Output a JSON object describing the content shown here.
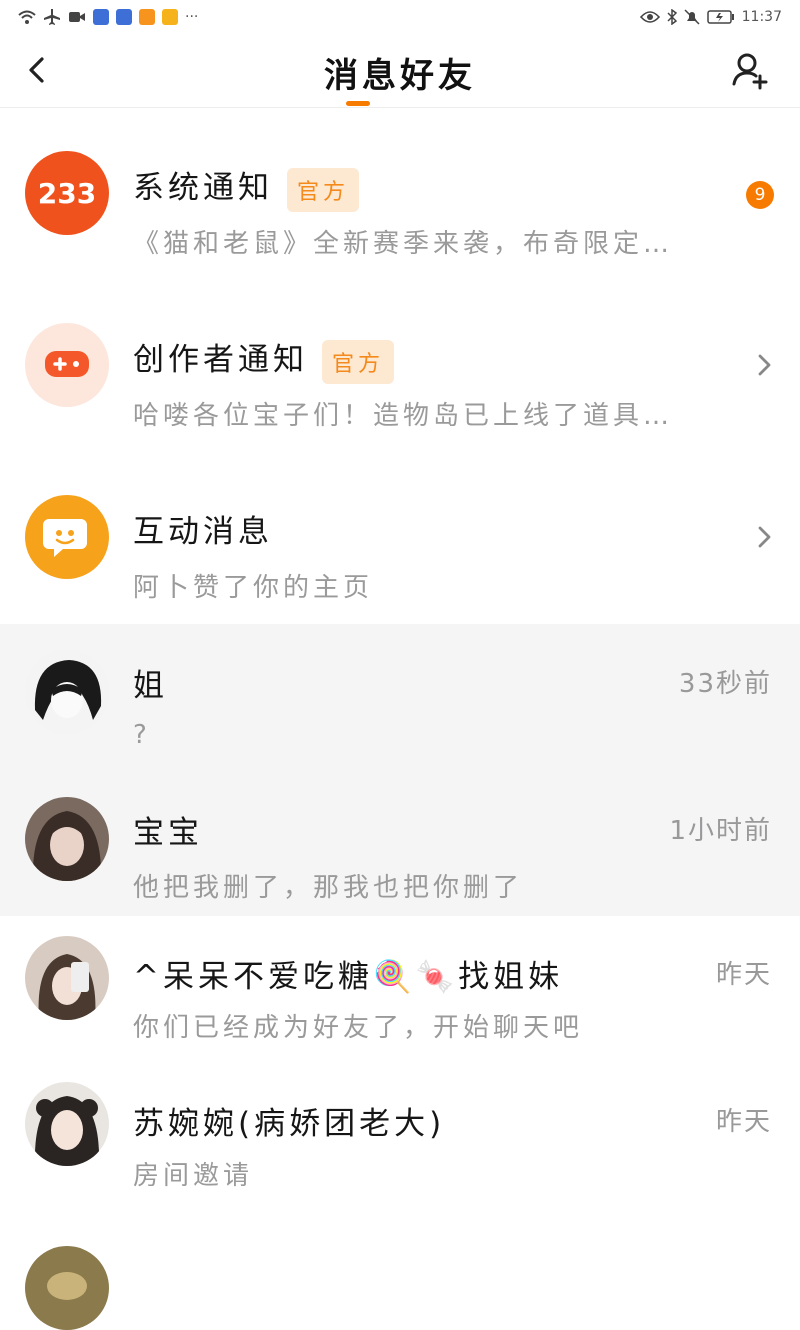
{
  "status_bar": {
    "time": "11:37"
  },
  "header": {
    "title": "消息好友"
  },
  "official": [
    {
      "avatar_text": "233",
      "name": "系统通知",
      "tag": "官方",
      "preview": "《猫和老鼠》全新赛季来袭，布奇限定…",
      "badge": "9"
    },
    {
      "name": "创作者通知",
      "tag": "官方",
      "preview": "哈喽各位宝子们！造物岛已上线了道具…"
    },
    {
      "name": "互动消息",
      "preview": "阿卜赞了你的主页"
    }
  ],
  "chats": [
    {
      "name": "姐",
      "preview": "?",
      "time": "33秒前"
    },
    {
      "name": "宝宝",
      "preview": "他把我删了，那我也把你删了",
      "time": "1小时前"
    },
    {
      "name": "^呆呆不爱吃糖🍭🍬找姐妹",
      "preview": "你们已经成为好友了，开始聊天吧",
      "time": "昨天"
    },
    {
      "name": "苏婉婉(病娇团老大)",
      "preview": "房间邀请",
      "time": "昨天"
    },
    {
      "name": "",
      "preview": "",
      "time": ""
    }
  ],
  "colors": {
    "accent": "#f77b00",
    "tag_bg": "#fde8d2",
    "tag_text": "#f48a1c",
    "highlight_bg": "#f5f5f6"
  },
  "icons": [
    "wifi-icon",
    "airplane-icon",
    "video-icon",
    "eye-icon",
    "bluetooth-icon",
    "bell-off-icon",
    "battery-icon",
    "back-arrow-icon",
    "add-friend-icon",
    "chevron-right-icon",
    "gamepad-icon",
    "chat-bubble-icon"
  ]
}
